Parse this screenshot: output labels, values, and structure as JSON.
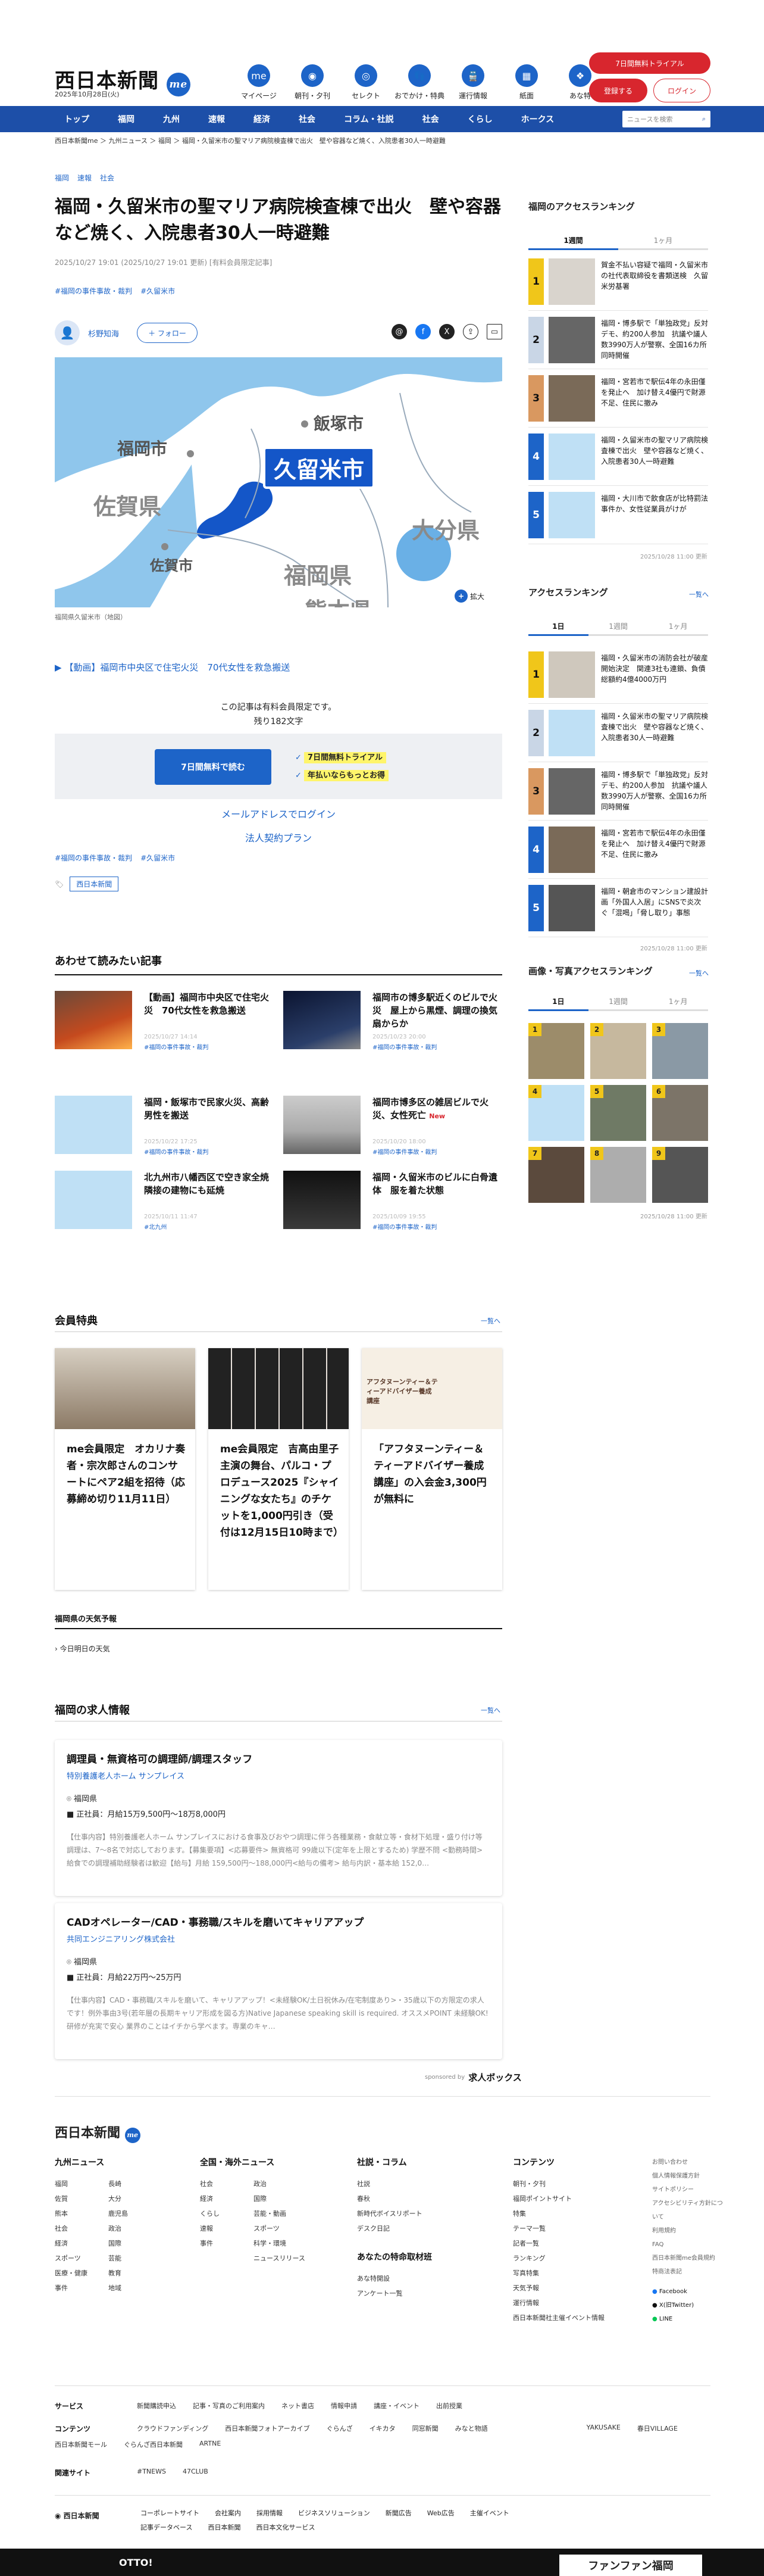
{
  "header": {
    "logo": "西日本新聞",
    "logo_badge": "me",
    "date": "2025年10月28日(火)",
    "nav_icons": [
      {
        "label": "マイページ",
        "icon": "me"
      },
      {
        "label": "朝刊・夕刊",
        "icon": "◉"
      },
      {
        "label": "セレクト",
        "icon": "◎"
      },
      {
        "label": "おでかけ・特典",
        "icon": "👣"
      },
      {
        "label": "運行情報",
        "icon": "🚆"
      },
      {
        "label": "紙面",
        "icon": "▦"
      },
      {
        "label": "あな特",
        "icon": "❖"
      }
    ],
    "trial_pill": "7日間無料トライアル",
    "register": "登録する",
    "login": "ログイン"
  },
  "mainnav": [
    "トップ",
    "福岡",
    "九州",
    "速報",
    "経済",
    "社会",
    "コラム・社説",
    "社会",
    "くらし",
    "ホークス"
  ],
  "mainnav_search": "ニュースを検索",
  "breadcrumb": "西日本新聞me ＞ 九州ニュース ＞ 福岡 ＞ 福岡・久留米市の聖マリア病院検査棟で出火　壁や容器など焼く、入院患者30人一時避難",
  "article": {
    "top_tags": [
      "福岡",
      "速報",
      "社会"
    ],
    "title": "福岡・久留米市の聖マリア病院検査棟で出火　壁や容器など焼く、入院患者30人一時避難",
    "meta": "2025/10/27 19:01 (2025/10/27 19:01 更新) [有料会員限定記事]",
    "hashtags": [
      "#福岡の事件事故・裁判",
      "#久留米市"
    ],
    "author": "杉野知海",
    "follow": "＋ フォロー",
    "map_labels": {
      "iizuka": "飯塚市",
      "fukuoka_city": "福岡市",
      "kurume": "久留米市",
      "saga": "佐賀県",
      "saga_city": "佐賀市",
      "fukuoka_pref": "福岡県",
      "oita": "大分県",
      "kumamoto": "熊本県",
      "watermark": "西日",
      "zoom": "拡大"
    },
    "caption": "福岡県久留米市（地図）",
    "video_link": "【動画】福岡市中央区で住宅火災　70代女性を救急搬送",
    "paywall_note": "この記事は有料会員限定です。",
    "remaining": "残り182文字",
    "try_button": "7日間無料で読む",
    "bullet1": "7日間無料トライアル",
    "bullet2": "年払いならもっとお得",
    "email_login": "メールアドレスでログイン",
    "corporate": "法人契約プラン",
    "hashtags2": [
      "#福岡の事件事故・裁判",
      "#久留米市"
    ],
    "publisher_tag": "西日本新聞"
  },
  "related": {
    "heading": "あわせて読みたい記事",
    "items": [
      {
        "title": "【動画】福岡市中央区で住宅火災　70代女性を救急搬送",
        "date": "2025/10/27 14:14",
        "tag": "#福岡の事件事故・裁判"
      },
      {
        "title": "福岡市の博多駅近くのビルで火災　屋上から黒煙、調理の換気扇からか",
        "date": "2025/10/23 20:00",
        "tag": "#福岡の事件事故・裁判"
      },
      {
        "title": "福岡・飯塚市で民家火災、高齢男性を搬送",
        "date": "2025/10/22 17:25",
        "tag": "#福岡の事件事故・裁判"
      },
      {
        "title": "福岡市博多区の雑居ビルで火災、女性死亡",
        "date": "2025/10/20 18:00",
        "tag": "#福岡の事件事故・裁判",
        "badge": "New"
      },
      {
        "title": "北九州市八幡西区で空き家全焼　隣接の建物にも延焼",
        "date": "2025/10/11 11:47",
        "tag": "#北九州"
      },
      {
        "title": "福岡・久留米市のビルに白骨遺体　服を着た状態",
        "date": "2025/10/09 19:55",
        "tag": "#福岡の事件事故・裁判"
      }
    ]
  },
  "perks": {
    "heading": "会員特典",
    "more": "一覧へ",
    "items": [
      {
        "text": "me会員限定　オカリナ奏者・宗次郎さんのコンサートにペア2組を招待（応募締め切り11月11日）"
      },
      {
        "text": "me会員限定　吉高由里子主演の舞台、パルコ・プロデュース2025『シャイニングな女たち』のチケットを1,000円引き（受付は12月15日10時まで）"
      },
      {
        "text": "「アフタヌーンティー＆ティーアドバイザー養成講座」の入会金3,300円が無料に",
        "img_text": "アフタヌーンティー＆ティーアドバイザー養成講座"
      }
    ]
  },
  "weather": {
    "heading": "福岡県の天気予報",
    "link": "今日明日の天気"
  },
  "jobs": {
    "heading": "福岡の求人情報",
    "more": "一覧へ",
    "items": [
      {
        "title": "調理員・無資格可の調理師/調理スタッフ",
        "company": "特別養護老人ホーム サンプレイス",
        "location": "福岡県",
        "salary": "正社員：月給15万9,500円〜18万8,000円",
        "desc": "【仕事内容】特別養護老人ホーム サンプレイスにおける食事及びおやつ調理に伴う各種業務・食献立等・食材下処理・盛り付け等 調理は、7〜8名で対応しております。【募集要項】<応募要件> 無資格可 99歳以下(定年を上限とするため) 学歴不問 <勤務時間> 給食での調理補助経験者は歓迎【給与】月給 159,500円〜188,000円<給与の備考> 給与内訳・基本給 152,0…"
      },
      {
        "title": "CADオペレーター/CAD・事務職/スキルを磨いてキャリアアップ",
        "company": "共同エンジニアリング株式会社",
        "location": "福岡県",
        "salary": "正社員：月給22万円〜25万円",
        "desc": "【仕事内容】CAD・事務職/スキルを磨いて、キャリアアップ！<未経験OK/土日祝休み/在宅制度あり>・35歳以下の方限定の求人です！例外事由3号(若年層の長期キャリア形成を図る方)Native Japanese speaking skill is required. オススメPOINT 未経験OK!研修が充実で安心 業界のことはイチから学べます。専業のキャ…"
      }
    ],
    "sponsor": "sponsored by",
    "sponsor_name": "求人ボックス"
  },
  "sidebar": {
    "fukuoka_ranking": {
      "heading": "福岡のアクセスランキング",
      "tabs": [
        "1週間",
        "1ヶ月"
      ],
      "items": [
        "賀金不払い容疑で福岡・久留米市の社代表取締役を書類送検　久留米労基署",
        "福岡・博多駅で「単独政党」反対デモ、約200人参加　抗議や議人数3990万人が警察、全国16カ所同時開催",
        "福岡・宮若市で駅伝4年の永田僅を発止へ　加け替え4優円で財源不足、住民に撤み",
        "福岡・久留米市の聖マリア病院検査棟で出火　壁や容器など焼く、入院患者30人一時避難",
        "福岡・大川市で飲食店が比特罰法事件か、女性従業員がけが"
      ],
      "updated": "2025/10/28 11:00 更新"
    },
    "access_ranking": {
      "heading": "アクセスランキング",
      "more": "一覧へ",
      "tabs": [
        "1日",
        "1週間",
        "1ヶ月"
      ],
      "items": [
        "福岡・久留米市の消防会社が破産開始決定　関連3社も連鎖、負債総額約4億4000万円",
        "福岡・久留米市の聖マリア病院検査棟で出火　壁や容器など焼く、入院患者30人一時避難",
        "福岡・博多駅で「単独政党」反対デモ、約200人参加　抗議や議人数3990万人が警察、全国16カ所同時開催",
        "福岡・宮若市で駅伝4年の永田僅を発止へ　加け替え4優円で財源不足、住民に撤み",
        "福岡・朝倉市のマンション建設計画「外国人入居」にSNSで炎次ぐ「混喝」「脅し取り」事態"
      ],
      "updated": "2025/10/28 11:00 更新"
    },
    "photo_ranking": {
      "heading": "画像・写真アクセスランキング",
      "more": "一覧へ",
      "tabs": [
        "1日",
        "1週間",
        "1ヶ月"
      ],
      "updated": "2025/10/28 11:00 更新"
    }
  },
  "footer": {
    "logo": "西日本新聞",
    "cols": [
      {
        "heading": "九州ニュース",
        "links": [
          "福岡",
          "長崎",
          "佐賀",
          "大分",
          "熊本",
          "鹿児島",
          "社会",
          "政治",
          "経済",
          "国際",
          "スポーツ",
          "芸能",
          "医療・健康",
          "教育",
          "事件",
          "地域"
        ]
      },
      {
        "heading": "全国・海外ニュース",
        "links": [
          "社会",
          "政治",
          "経済",
          "国際",
          "くらし",
          "芸能・動画",
          "速報",
          "スポーツ",
          "事件",
          "科学・環境",
          "ニュースリリース"
        ]
      },
      {
        "heading": "社説・コラム",
        "links": [
          "社説",
          "春秋",
          "新時代ボイスリポート",
          "デスク日記"
        ]
      },
      {
        "heading": "コンテンツ",
        "links": [
          "朝刊・夕刊",
          "福岡ポイントサイト",
          "特集",
          "テーマ一覧",
          "記者一覧",
          "ランキング",
          "写真特集",
          "天気予報",
          "運行情報",
          "西日本新聞社主催イベント情報"
        ]
      }
    ],
    "side_links": [
      "お問い合わせ",
      "個人情報保護方針",
      "サイトポリシー",
      "アクセシビリティ方針について",
      "利用規約",
      "FAQ",
      "西日本新聞me会員規約",
      "特商法表記"
    ],
    "social": [
      "Facebook",
      "X(旧Twitter)",
      "LINE"
    ],
    "assistance": {
      "heading": "あなたの特命取材班",
      "links": [
        "あな特開設",
        "アンケート一覧"
      ]
    },
    "rows": [
      {
        "label": "サービス",
        "links": [
          "新聞購読申込",
          "記事・写真のご利用案内",
          "ネット書店",
          "情報申請",
          "講座・イベント",
          "出前授業"
        ]
      },
      {
        "label": "コンテンツ",
        "links": [
          "クラウドファンディング",
          "西日本新聞フォトアーカイブ",
          "ぐらんざ",
          "イキカタ",
          "同窓新聞",
          "みなと物語",
          "YAKUSAKE",
          "春日VILLAGE",
          "西日本新聞モール",
          "ぐらんざ西日本新聞",
          "ARTNE"
        ]
      },
      {
        "label": "関連サイト",
        "links": [
          "#TNEWS",
          "47CLUB"
        ]
      }
    ],
    "company_links": [
      "コーポレートサイト",
      "会社案内",
      "採用情報",
      "ビジネスソリューション",
      "新聞広告",
      "Web広告",
      "主催イベント",
      "記事データベース",
      "西日本新聞",
      "西日本文化サービス"
    ],
    "bottom_ad": "ファンファン福岡",
    "bottom_left": "OTTO!"
  },
  "colors": {
    "brand_blue": "#1d4fa8",
    "accent_blue": "#1d64c8",
    "red": "#d8262e",
    "highlight": "#fff56b"
  }
}
